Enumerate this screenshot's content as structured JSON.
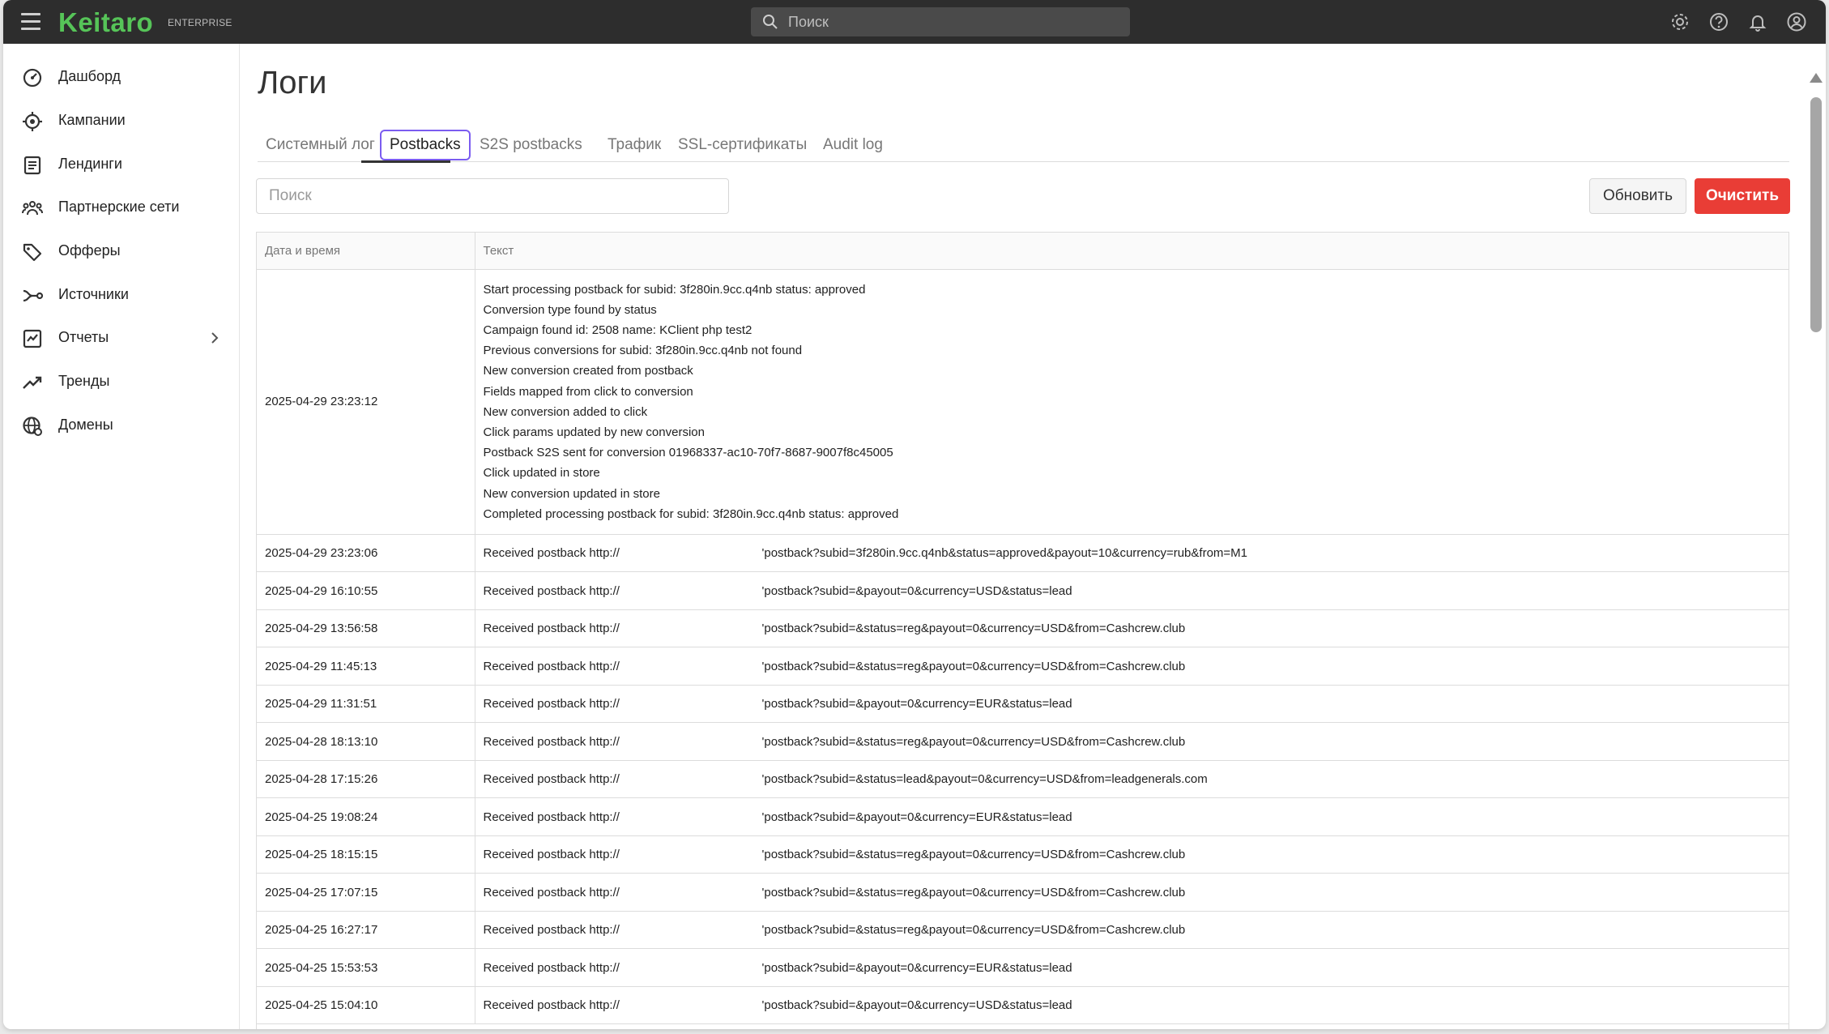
{
  "header": {
    "logo": "Keitaro",
    "edition": "ENTERPRISE",
    "search_placeholder": "Поиск"
  },
  "icons": {
    "top": [
      "settings-icon",
      "help-icon",
      "bell-icon",
      "account-icon"
    ]
  },
  "sidebar": {
    "items": [
      {
        "label": "Дашборд",
        "icon": "dashboard-icon"
      },
      {
        "label": "Кампании",
        "icon": "campaigns-icon"
      },
      {
        "label": "Лендинги",
        "icon": "landings-icon"
      },
      {
        "label": "Партнерские сети",
        "icon": "affiliate-networks-icon"
      },
      {
        "label": "Офферы",
        "icon": "offers-icon"
      },
      {
        "label": "Источники",
        "icon": "sources-icon"
      },
      {
        "label": "Отчеты",
        "icon": "reports-icon"
      },
      {
        "label": "Тренды",
        "icon": "trends-icon"
      },
      {
        "label": "Домены",
        "icon": "domains-icon"
      }
    ]
  },
  "page": {
    "title": "Логи",
    "tabs": [
      {
        "label": "Системный лог"
      },
      {
        "label": "Postbacks",
        "active": true
      },
      {
        "label": "S2S postbacks"
      },
      {
        "label": "Трафик"
      },
      {
        "label": "SSL-сертификаты"
      },
      {
        "label": "Audit log"
      }
    ],
    "search_placeholder": "Поиск",
    "refresh_label": "Обновить",
    "clear_label": "Очистить"
  },
  "colors": {
    "brand": "#56c458",
    "danger": "#e93d36",
    "active_tab_border": "#7b5cf0"
  },
  "table": {
    "headers": [
      "Дата и время",
      "Текст"
    ],
    "multi_row": {
      "datetime": "2025-04-29 23:23:12",
      "lines": [
        "Start processing postback for subid: 3f280in.9cc.q4nb status: approved",
        "Conversion type found by status",
        "Campaign found id: 2508 name: KClient php test2",
        "Previous conversions for subid: 3f280in.9cc.q4nb not found",
        "New conversion created from postback",
        "Fields mapped from click to conversion",
        "New conversion added to click",
        "Click params updated by new conversion",
        "Postback S2S sent for conversion 01968337-ac10-70f7-8687-9007f8c45005",
        "Click updated in store",
        "New conversion updated in store",
        "Completed processing postback for subid: 3f280in.9cc.q4nb status: approved"
      ]
    },
    "rows": [
      {
        "datetime": "2025-04-29 23:23:06",
        "prefix": "Received postback http://",
        "path": "'postback?subid=3f280in.9cc.q4nb&status=approved&payout=10&currency=rub&from=M1"
      },
      {
        "datetime": "2025-04-29 16:10:55",
        "prefix": "Received postback http://",
        "path": "'postback?subid=&payout=0&currency=USD&status=lead"
      },
      {
        "datetime": "2025-04-29 13:56:58",
        "prefix": "Received postback http://",
        "path": "'postback?subid=&status=reg&payout=0&currency=USD&from=Cashcrew.club"
      },
      {
        "datetime": "2025-04-29 11:45:13",
        "prefix": "Received postback http://",
        "path": "'postback?subid=&status=reg&payout=0&currency=USD&from=Cashcrew.club"
      },
      {
        "datetime": "2025-04-29 11:31:51",
        "prefix": "Received postback http://",
        "path": "'postback?subid=&payout=0&currency=EUR&status=lead"
      },
      {
        "datetime": "2025-04-28 18:13:10",
        "prefix": "Received postback http://",
        "path": "'postback?subid=&status=reg&payout=0&currency=USD&from=Cashcrew.club"
      },
      {
        "datetime": "2025-04-28 17:15:26",
        "prefix": "Received postback http://",
        "path": "'postback?subid=&status=lead&payout=0&currency=USD&from=leadgenerals.com"
      },
      {
        "datetime": "2025-04-25 19:08:24",
        "prefix": "Received postback http://",
        "path": "'postback?subid=&payout=0&currency=EUR&status=lead"
      },
      {
        "datetime": "2025-04-25 18:15:15",
        "prefix": "Received postback http://",
        "path": "'postback?subid=&status=reg&payout=0&currency=USD&from=Cashcrew.club"
      },
      {
        "datetime": "2025-04-25 17:07:15",
        "prefix": "Received postback http://",
        "path": "'postback?subid=&status=reg&payout=0&currency=USD&from=Cashcrew.club"
      },
      {
        "datetime": "2025-04-25 16:27:17",
        "prefix": "Received postback http://",
        "path": "'postback?subid=&status=reg&payout=0&currency=USD&from=Cashcrew.club"
      },
      {
        "datetime": "2025-04-25 15:53:53",
        "prefix": "Received postback http://",
        "path": "'postback?subid=&payout=0&currency=EUR&status=lead"
      },
      {
        "datetime": "2025-04-25 15:04:10",
        "prefix": "Received postback http://",
        "path": "'postback?subid=&payout=0&currency=USD&status=lead"
      }
    ]
  }
}
